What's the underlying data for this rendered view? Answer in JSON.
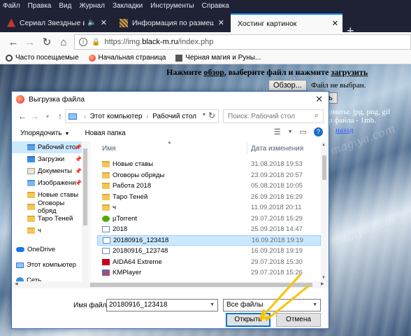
{
  "menu": [
    "Файл",
    "Правка",
    "Вид",
    "Журнал",
    "Закладки",
    "Инструменты",
    "Справка"
  ],
  "tabs": [
    {
      "label": "Сериал Звездные врата",
      "icon": "tv-icon",
      "active": false,
      "audio": true
    },
    {
      "label": "Информация по размещению",
      "icon": "info-icon",
      "active": false,
      "audio": false
    },
    {
      "label": "Хостинг картинок",
      "icon": "",
      "active": true,
      "audio": false
    }
  ],
  "url": {
    "prefix": "https://img.",
    "domain": "black-m.ru",
    "path": "/index.php"
  },
  "bookmarks": [
    {
      "label": "Часто посещаемые",
      "icon": "gear-icon"
    },
    {
      "label": "Начальная страница",
      "icon": "firefox-icon"
    },
    {
      "label": "Черная магия и Руны...",
      "icon": "page-icon"
    }
  ],
  "upload": {
    "line1_a": "Нажмите ",
    "line1_link1": "обзор",
    "line1_b": ", выберите файл и нажмите ",
    "line1_link2": "загрузить",
    "browse_label": "Обзор...",
    "no_file": "Файл не выбран.",
    "upload_button_partial": "ить",
    "formats_text": "рматы: jpg, png, gif",
    "size_text": "р файла - 1mb.",
    "back_link": "назад"
  },
  "dialog": {
    "title": "Выгрузка файла",
    "breadcrumb": [
      "Этот компьютер",
      "Рабочий стол"
    ],
    "search_placeholder": "Поиск: Рабочий стол",
    "organize": "Упорядочить",
    "new_folder": "Новая папка",
    "col_name": "Имя",
    "col_date": "Дата изменения",
    "nav_items": [
      {
        "label": "Рабочий стол",
        "kind": "folder-blue",
        "pin": true,
        "selected": true
      },
      {
        "label": "Загрузки",
        "kind": "download",
        "pin": true,
        "selected": false
      },
      {
        "label": "Документы",
        "kind": "docs",
        "pin": true,
        "selected": false
      },
      {
        "label": "Изображени",
        "kind": "images",
        "pin": true,
        "selected": false
      },
      {
        "label": "Новые ставы",
        "kind": "folder",
        "pin": false,
        "selected": false
      },
      {
        "label": "Оговоры обряд",
        "kind": "folder",
        "pin": false,
        "selected": false
      },
      {
        "label": "Таро Теней",
        "kind": "folder",
        "pin": false,
        "selected": false
      },
      {
        "label": "ч",
        "kind": "folder",
        "pin": false,
        "selected": false
      },
      {
        "label": "OneDrive",
        "kind": "onedrive",
        "pin": false,
        "selected": false
      },
      {
        "label": "Этот компьютер",
        "kind": "pc",
        "pin": false,
        "selected": false
      },
      {
        "label": "Сеть",
        "kind": "network",
        "pin": false,
        "selected": false
      }
    ],
    "files": [
      {
        "name": "Новые ставы",
        "date": "31.08.2018 19:53",
        "kind": "folder"
      },
      {
        "name": "Оговоры обряды",
        "date": "23.09.2018 20:57",
        "kind": "folder"
      },
      {
        "name": "Работа 2018",
        "date": "05.08.2018 10:05",
        "kind": "folder"
      },
      {
        "name": "Таро Теней",
        "date": "26.09.2018 16:29",
        "kind": "folder"
      },
      {
        "name": "ч",
        "date": "11.09.2018 20:11",
        "kind": "folder"
      },
      {
        "name": "µTorrent",
        "date": "29.07.2018 15:29",
        "kind": "app"
      },
      {
        "name": "2018",
        "date": "25.09.2018 14:47",
        "kind": "file"
      },
      {
        "name": "20180916_123418",
        "date": "16.09.2018 19:19",
        "kind": "image",
        "selected": true
      },
      {
        "name": "20180916_123748",
        "date": "16.09.2018 19:19",
        "kind": "image"
      },
      {
        "name": "AIDA64 Extreme",
        "date": "29.07.2018 15:30",
        "kind": "aida"
      },
      {
        "name": "KMPlayer",
        "date": "29.07.2018 15:26",
        "kind": "kmp"
      }
    ],
    "filename_label": "Имя файла:",
    "filename_value": "20180916_123418",
    "filetype_value": "Все файлы",
    "open_label": "Открыть",
    "cancel_label": "Отмена"
  },
  "watermark": "magiya.com",
  "colors": {
    "accent": "#0078d7",
    "arrow": "#f5c400",
    "selection": "#cce8ff"
  }
}
